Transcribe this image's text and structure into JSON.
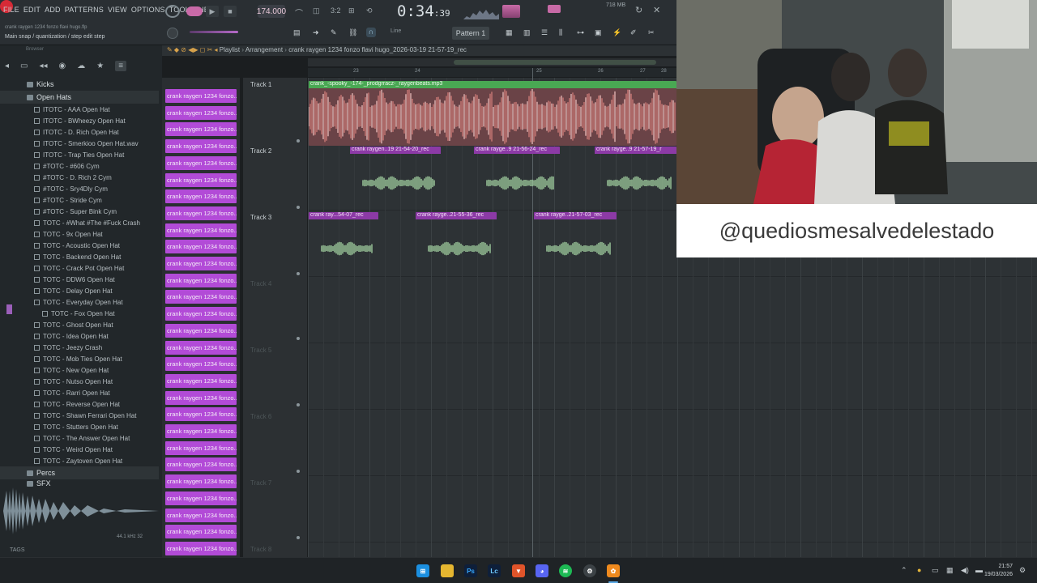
{
  "menu": {
    "items": [
      "FILE",
      "EDIT",
      "ADD",
      "PATTERNS",
      "VIEW",
      "OPTIONS",
      "TOOLS",
      "HELP"
    ],
    "project_hint": "crank raygen 1234 fonzo flavi hugo.flp",
    "hint_line": "Main snap / quantization / step edit step"
  },
  "transport": {
    "tempo": "174.000",
    "song_time": "0:34",
    "song_time_frac": ":39",
    "memory": "718 MB",
    "pattern": "Pattern 1",
    "snap_mode": "Line"
  },
  "browser": {
    "label": "Browser",
    "folders": [
      {
        "name": "Kicks",
        "open": false
      },
      {
        "name": "Open Hats",
        "open": true
      }
    ],
    "files": [
      "ITOTC - AAA Open Hat",
      "ITOTC - BWheezy Open Hat",
      "ITOTC - D. Rich Open Hat",
      "ITOTC - Smerkioo Open Hat.wav",
      "ITOTC - Trap Ties Open Hat",
      "#TOTC - #606 Cym",
      "#TOTC - D. Rich 2 Cym",
      "#TOTC - Sry4Dly Cym",
      "#TOTC - Stride Cym",
      "#TOTC - Super Bink Cym",
      "TOTC - #What #The #Fuck Crash",
      "TOTC - 9x Open Hat",
      "TOTC - Acoustic Open Hat",
      "TOTC - Backend Open Hat",
      "TOTC - Crack Pot Open Hat",
      "TOTC - DDW6 Open Hat",
      "TOTC - Delay Open Hat",
      "TOTC - Everyday Open Hat",
      "TOTC - Fox Open Hat",
      "TOTC - Ghost Open Hat",
      "TOTC - Idea Open Hat",
      "TOTC - Jeezy Crash",
      "TOTC - Mob Ties Open Hat",
      "TOTC - New Open Hat",
      "TOTC - Nutso Open Hat",
      "TOTC - Rarri Open Hat",
      "TOTC - Reverse Open Hat",
      "TOTC - Shawn Ferrari Open Hat",
      "TOTC - Stutters Open Hat",
      "TOTC - The Answer Open Hat",
      "TOTC - Weird Open Hat",
      "TOTC - Zaytoven Open Hat"
    ],
    "after_folders": [
      "Percs",
      "SFX"
    ],
    "sample_rate": "44.1 kHz 32",
    "tags_label": "TAGS"
  },
  "channels": {
    "label": "crank raygen 1234 fonzo...",
    "count": 29
  },
  "playlist": {
    "title": "Playlist",
    "section": "Arrangement",
    "file": "crank raygen 1234 fonzo flavi hugo_2026-03-19 21-57-19_rec",
    "ruler_marks": [
      "23",
      "24",
      "25",
      "26",
      "27",
      "28"
    ],
    "tracks": [
      "Track 1",
      "Track 2",
      "Track 3",
      "Track 4",
      "Track 5",
      "Track 6",
      "Track 7",
      "Track 8"
    ],
    "clips": {
      "t1": "crank_-spooky_-174-_prodgrracz-_raygenbeats.mp3",
      "t2a": "crank raygen..19 21-54-20_rec",
      "t2b": "crank rayge..9 21-56-24_rec",
      "t2c": "crank rayge..9 21-57-19_r",
      "t3a": "crank ray...54-07_rec",
      "t3b": "crank rayge..21-55-36_rec",
      "t3c": "crank rayge..21-57-03_rec"
    }
  },
  "overlay": {
    "handle": "@quediosmesalvedelestado"
  },
  "taskbar": {
    "time": "21:57",
    "date": "19/03/2026",
    "apps": [
      "start",
      "explorer",
      "photoshop",
      "lightroom",
      "brave",
      "discord",
      "spotify",
      "settings",
      "fl-studio"
    ]
  },
  "colors": {
    "channel": "#b24bd7",
    "audio_clip_header": "#49a853",
    "recording_clip_header": "#8c3aa6",
    "record_button": "#d62a36"
  }
}
